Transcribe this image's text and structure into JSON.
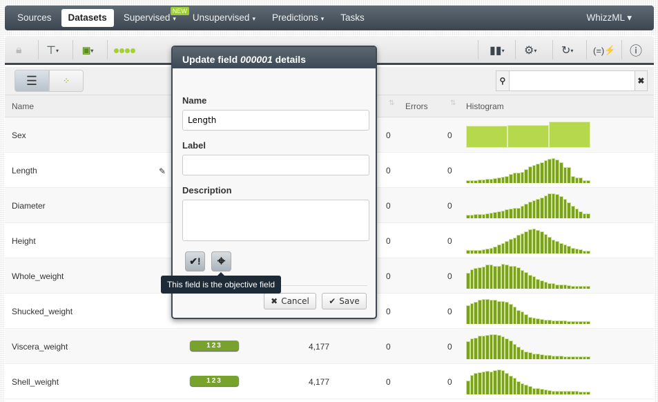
{
  "nav": {
    "items": [
      {
        "label": "Sources"
      },
      {
        "label": "Datasets",
        "active": true
      },
      {
        "label": "Supervised",
        "caret": "▾",
        "badge": "NEW"
      },
      {
        "label": "Unsupervised",
        "caret": "▾"
      },
      {
        "label": "Predictions",
        "caret": "▾"
      },
      {
        "label": "Tasks"
      }
    ],
    "right": "WhizzML ▾"
  },
  "search": {
    "value": "",
    "placeholder": ""
  },
  "table": {
    "headers": {
      "name": "Name",
      "errors": "Errors",
      "histogram": "Histogram"
    },
    "rows": [
      {
        "name": "Sex",
        "missing": "0",
        "errors": "0",
        "categorical": true,
        "hist": [
          85,
          88,
          100
        ]
      },
      {
        "name": "Length",
        "missing": "0",
        "errors": "0",
        "hist": [
          10,
          10,
          10,
          12,
          13,
          14,
          15,
          17,
          20,
          21,
          25,
          30,
          37,
          36,
          39,
          47,
          57,
          61,
          68,
          72,
          78,
          84,
          86,
          82,
          72,
          54,
          54,
          25,
          20,
          20,
          10,
          10
        ]
      },
      {
        "name": "Diameter",
        "missing": "0",
        "errors": "0",
        "hist": [
          12,
          12,
          13,
          13,
          14,
          16,
          18,
          20,
          22,
          25,
          28,
          30,
          32,
          34,
          39,
          46,
          53,
          58,
          62,
          66,
          73,
          79,
          79,
          76,
          71,
          61,
          50,
          40,
          30,
          23,
          15,
          15
        ]
      },
      {
        "name": "Height",
        "missing": "0",
        "errors": "0",
        "hist": [
          11,
          11,
          11,
          12,
          14,
          16,
          20,
          24,
          30,
          36,
          44,
          50,
          56,
          64,
          70,
          76,
          83,
          86,
          82,
          77,
          66,
          58,
          48,
          43,
          37,
          32,
          26,
          20,
          16,
          14,
          9,
          9
        ]
      },
      {
        "name": "Whole_weight",
        "missing": "0",
        "errors": "0",
        "hist": [
          64,
          78,
          82,
          85,
          90,
          96,
          98,
          92,
          92,
          100,
          98,
          93,
          92,
          86,
          76,
          67,
          56,
          49,
          40,
          32,
          28,
          22,
          22,
          17,
          17,
          17,
          13,
          12,
          12,
          12,
          12,
          12
        ]
      },
      {
        "name": "Shucked_weight",
        "missing": "0",
        "errors": "0",
        "hist": [
          75,
          84,
          88,
          96,
          100,
          100,
          98,
          97,
          93,
          91,
          89,
          81,
          69,
          56,
          49,
          39,
          29,
          24,
          21,
          19,
          17,
          16,
          15,
          15,
          14,
          13,
          12,
          12,
          12,
          12,
          12,
          12
        ]
      },
      {
        "name": "Viscera_weight",
        "optype": "123",
        "count": "4,177",
        "missing": "0",
        "errors": "0",
        "hist": [
          74,
          86,
          89,
          95,
          96,
          100,
          102,
          101,
          100,
          94,
          86,
          76,
          63,
          51,
          41,
          32,
          27,
          24,
          24,
          19,
          17,
          16,
          14,
          13,
          13,
          12,
          12,
          12,
          12,
          12,
          12,
          12
        ]
      },
      {
        "name": "Shell_weight",
        "optype": "123",
        "count": "4,177",
        "missing": "0",
        "errors": "0",
        "hist": [
          60,
          84,
          92,
          96,
          100,
          103,
          98,
          104,
          108,
          104,
          94,
          82,
          72,
          56,
          47,
          42,
          35,
          28,
          27,
          23,
          20,
          17,
          16,
          15,
          14,
          14,
          14,
          14,
          14,
          12,
          12,
          12
        ]
      }
    ]
  },
  "modal": {
    "title_prefix": "Update field ",
    "field_id": "000001",
    "title_suffix": " details",
    "name_label": "Name",
    "name_value": "Length",
    "label_label": "Label",
    "label_value": "",
    "description_label": "Description",
    "description_value": "",
    "tooltip": "This field is the objective field",
    "cancel": "Cancel",
    "save": "Save"
  },
  "colors": {
    "nav": "#3b4650",
    "accent": "#7aa31b",
    "categorical": "#b6d84c",
    "badge": "#77a22b"
  }
}
